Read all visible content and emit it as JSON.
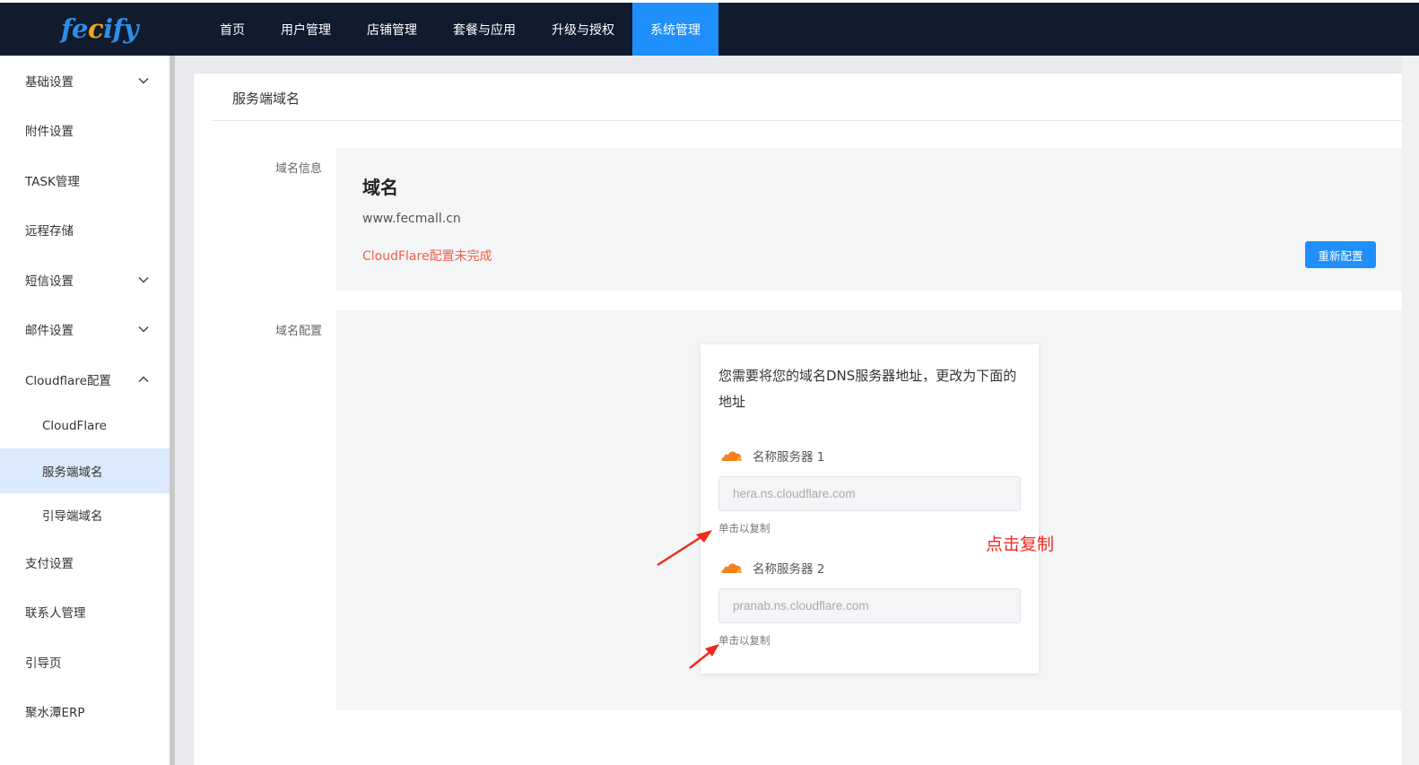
{
  "app": {
    "logo": "fecify",
    "accent_color": "#1f8ffb"
  },
  "topnav": {
    "items": [
      {
        "label": "首页"
      },
      {
        "label": "用户管理"
      },
      {
        "label": "店铺管理"
      },
      {
        "label": "套餐与应用"
      },
      {
        "label": "升级与授权"
      },
      {
        "label": "系统管理",
        "active": true
      }
    ]
  },
  "sidebar": {
    "items": [
      {
        "label": "基础设置",
        "icon": "chevron-down-icon"
      },
      {
        "label": "附件设置"
      },
      {
        "label": "TASK管理"
      },
      {
        "label": "远程存储"
      },
      {
        "label": "短信设置",
        "icon": "chevron-down-icon"
      },
      {
        "label": "邮件设置",
        "icon": "chevron-down-icon"
      },
      {
        "label": "Cloudflare配置",
        "icon": "chevron-up-icon"
      }
    ],
    "subitems": [
      {
        "label": "CloudFlare"
      },
      {
        "label": "服务端域名",
        "active": true
      },
      {
        "label": "引导端域名"
      }
    ],
    "items_after": [
      {
        "label": "支付设置"
      },
      {
        "label": "联系人管理"
      },
      {
        "label": "引导页"
      },
      {
        "label": "聚水潭ERP"
      }
    ]
  },
  "main": {
    "title": "服务端域名",
    "domain_info": {
      "label": "域名信息",
      "heading": "域名",
      "domain": "www.fecmall.cn",
      "status": "CloudFlare配置未完成",
      "status_color": "#f0604d",
      "button": "重新配置"
    },
    "domain_config": {
      "label": "域名配置",
      "intro": "您需要将您的域名DNS服务器地址，更改为下面的地址",
      "nameservers": [
        {
          "label": "名称服务器 1",
          "value": "hera.ns.cloudflare.com",
          "hint": "单击以复制",
          "icon": "cloudflare-icon"
        },
        {
          "label": "名称服务器 2",
          "value": "pranab.ns.cloudflare.com",
          "hint": "单击以复制",
          "icon": "cloudflare-icon"
        }
      ]
    }
  },
  "annotation": {
    "text": "点击复制",
    "color": "#f02a1d"
  }
}
